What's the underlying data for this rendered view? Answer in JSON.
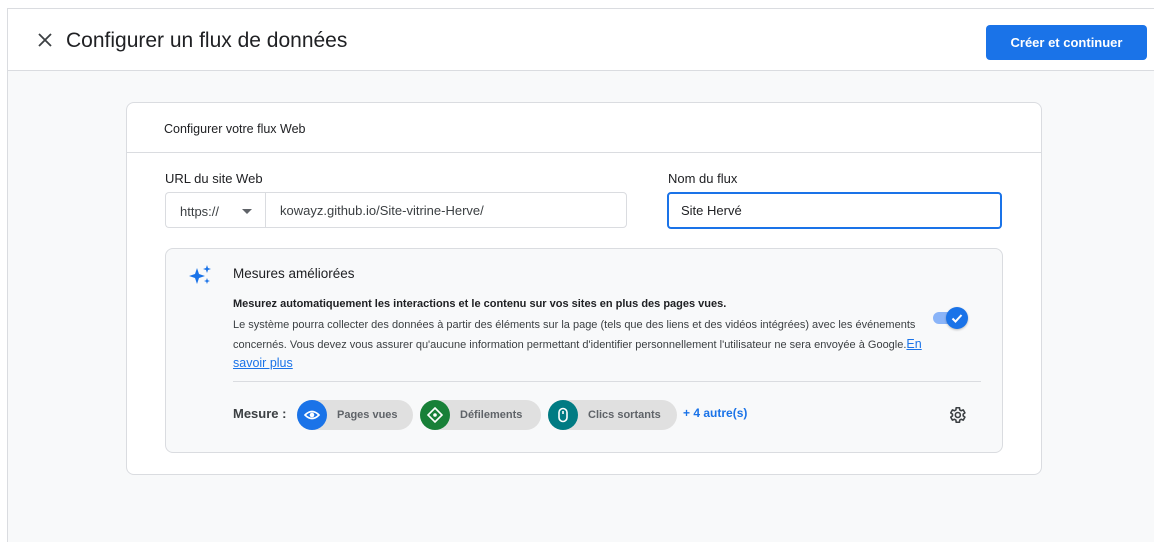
{
  "header": {
    "title": "Configurer un flux de données",
    "primary_button": "Créer et continuer"
  },
  "card": {
    "title": "Configurer votre flux Web",
    "url_label": "URL du site Web",
    "protocol": "https://",
    "url_value": "kowayz.github.io/Site-vitrine-Herve/",
    "name_label": "Nom du flux",
    "name_value": "Site Hervé"
  },
  "enhanced_measurement": {
    "title": "Mesures améliorées",
    "bold_text": "Mesurez automatiquement les interactions et le contenu sur vos sites en plus des pages vues.",
    "description": "Le système pourra collecter des données à partir des éléments sur la page (tels que des liens et des vidéos intégrées) avec les événements concernés. Vous devez vous assurer qu'aucune information permettant d'identifier personnellement l'utilisateur ne sera envoyée à Google.",
    "learn_more": "En savoir plus",
    "enabled": true,
    "measure_label": "Mesure :",
    "chips": [
      {
        "label": "Pages vues",
        "icon": "eye-icon",
        "color": "#1a73e8"
      },
      {
        "label": "Défilements",
        "icon": "scroll-icon",
        "color": "#188038"
      },
      {
        "label": "Clics sortants",
        "icon": "mouse-icon",
        "color": "#007b83"
      }
    ],
    "more": "+ 4 autre(s)",
    "settings_icon": "gear-icon"
  },
  "colors": {
    "accent": "#1a73e8",
    "border": "#dadce0",
    "panel_bg": "#f8f9fa"
  }
}
